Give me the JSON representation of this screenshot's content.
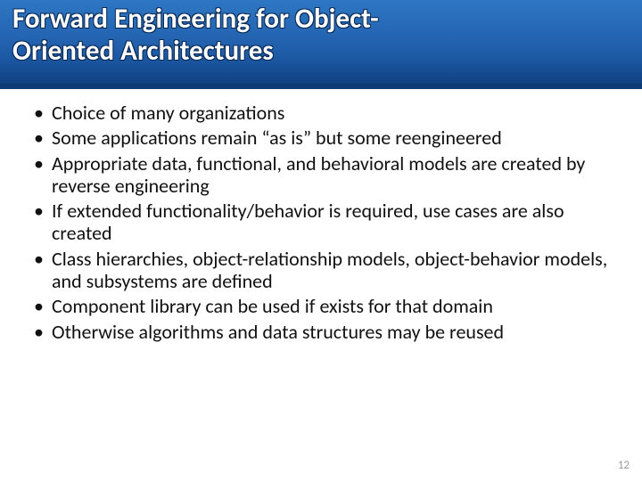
{
  "title": {
    "line1": "Forward Engineering for Object-",
    "line2": "Oriented Architectures"
  },
  "bullets": [
    "Choice of many organizations",
    "Some applications remain “as is” but some reengineered",
    "Appropriate data, functional, and behavioral models are created by reverse engineering",
    "If extended functionality/behavior is required, use cases are also created",
    "Class hierarchies, object-relationship models, object-behavior models, and subsystems are defined",
    "Component library can be used if exists for that domain",
    "Otherwise algorithms and data structures may be reused"
  ],
  "page_number": "12"
}
